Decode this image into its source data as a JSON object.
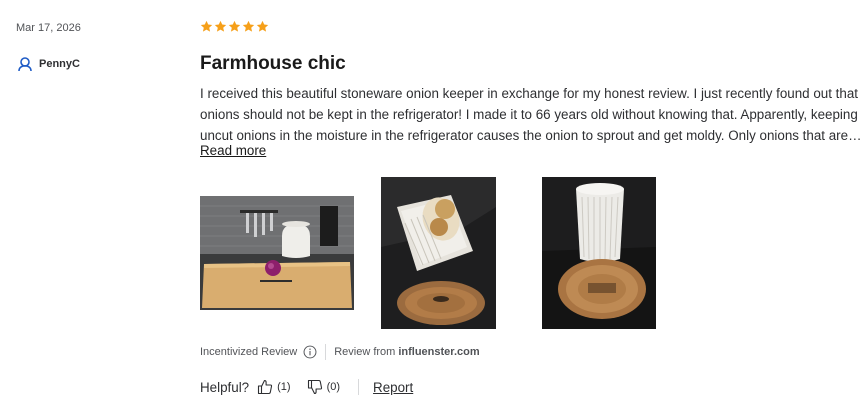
{
  "review": {
    "date": "Mar 17, 2026",
    "author": "PennyC",
    "rating": 5,
    "title": "Farmhouse chic",
    "text": "I received this beautiful stoneware onion keeper in exchange for my honest review. I just recently found out that onions should not be kept in the refrigerator! I made it to 66 years old without knowing that. Apparently, keeping uncut onions in the moisture in the refrigerator causes the onion to sprout and get moldy. Only onions that are cut...",
    "read_more": "Read more",
    "incentivized": "Incentivized Review",
    "source_prefix": "Review from",
    "source": "influenster.com",
    "helpful_label": "Helpful?",
    "helpful_yes_count": "(1)",
    "helpful_no_count": "(0)",
    "report": "Report"
  },
  "colors": {
    "star": "#f6a01a",
    "text": "#2e2f32",
    "muted": "#515357",
    "avatar": "#1e5bc6"
  }
}
